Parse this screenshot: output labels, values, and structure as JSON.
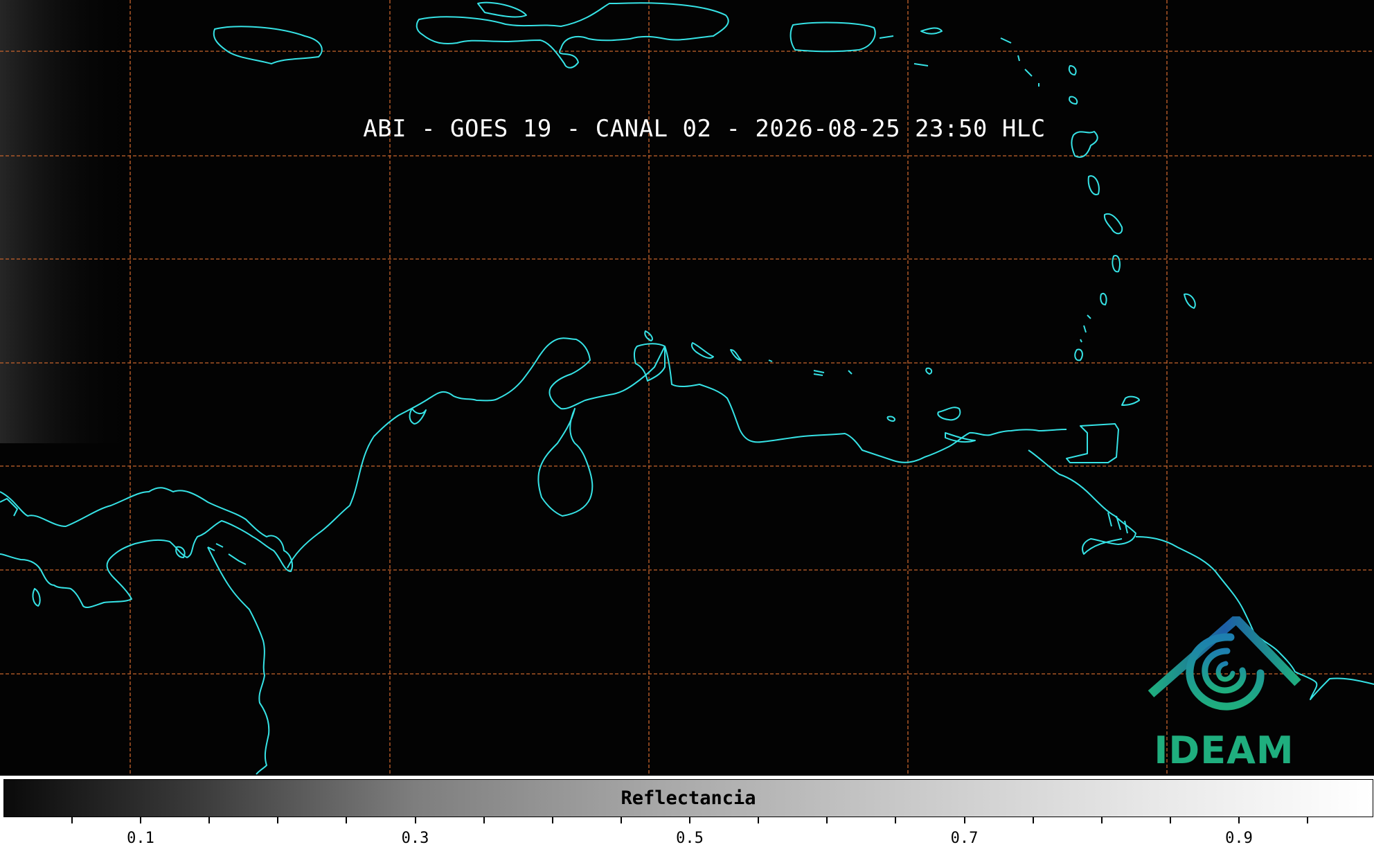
{
  "title": "ABI - GOES 19 - CANAL 02 - 2026-08-25 23:50 HLC",
  "logo": {
    "text": "IDEAM",
    "icon": "ideam-logo-icon"
  },
  "colorbar": {
    "label": "Reflectancia",
    "ticks": [
      "0.1",
      "0.3",
      "0.5",
      "0.7",
      "0.9"
    ]
  },
  "colors": {
    "coastline": "#36e3e6",
    "gridlines": "#c8642c",
    "logo_green": "#1fae7e",
    "logo_blue": "#1d5ea8"
  }
}
